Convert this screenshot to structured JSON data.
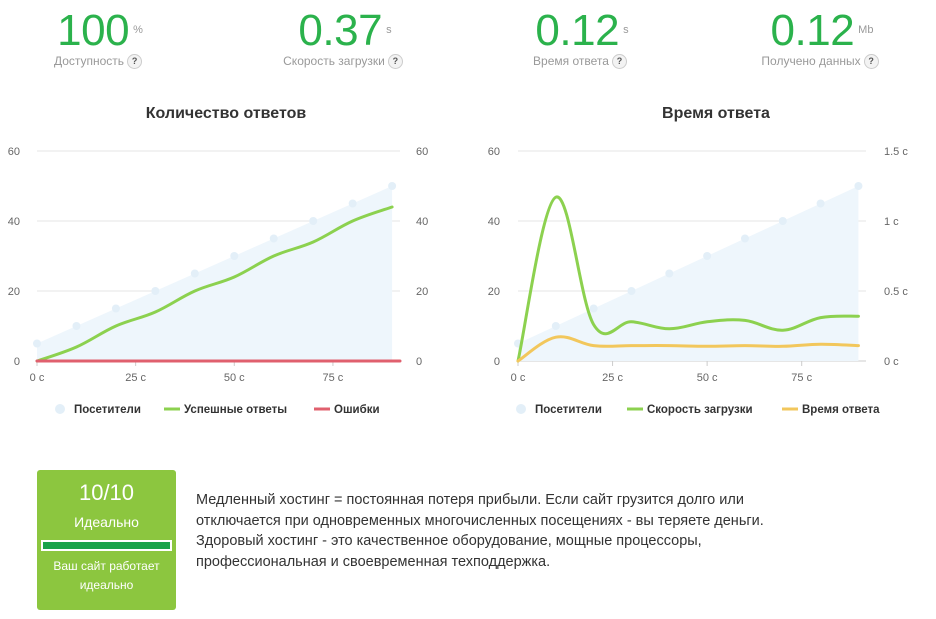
{
  "stats": [
    {
      "value": "100",
      "unit": "%",
      "label": "Доступность",
      "help": "?"
    },
    {
      "value": "0.37",
      "unit": "s",
      "label": "Скорость загрузки",
      "help": "?"
    },
    {
      "value": "0.12",
      "unit": "s",
      "label": "Время ответа",
      "help": "?"
    },
    {
      "value": "0.12",
      "unit": "Mb",
      "label": "Получено данных",
      "help": "?"
    }
  ],
  "colors": {
    "accent_green": "#2bb24c",
    "visitors_fill": "#eef6fc",
    "success_line": "#8cd14f",
    "errors_line": "#e0606e",
    "response_line": "#f2c75c",
    "card_green": "#8cc63f"
  },
  "chart_data": [
    {
      "type": "line",
      "title": "Количество ответов",
      "x": [
        0,
        10,
        20,
        30,
        40,
        50,
        60,
        70,
        80,
        90
      ],
      "x_ticks": [
        "0 с",
        "25 с",
        "50 с",
        "75 с"
      ],
      "x_tick_values": [
        0,
        25,
        50,
        75
      ],
      "xlim": [
        0,
        92
      ],
      "ylim": [
        0,
        60
      ],
      "y_ticks_left": [
        "0",
        "20",
        "40",
        "60"
      ],
      "y_ticks_right": [
        "0",
        "20",
        "40",
        "60"
      ],
      "grid": true,
      "legend_position": "bottom",
      "series": [
        {
          "name": "Посетители",
          "kind": "area",
          "color": "#eef6fc",
          "values": [
            5,
            10,
            15,
            20,
            25,
            30,
            35,
            40,
            45,
            50
          ]
        },
        {
          "name": "Успешные ответы",
          "kind": "line",
          "color": "#8cd14f",
          "values": [
            0,
            4,
            10,
            14,
            20,
            24,
            30,
            34,
            40,
            44
          ]
        },
        {
          "name": "Ошибки",
          "kind": "line",
          "color": "#e0606e",
          "values": [
            0,
            0,
            0,
            0,
            0,
            0,
            0,
            0,
            0,
            0
          ]
        }
      ]
    },
    {
      "type": "line",
      "title": "Время ответа",
      "x": [
        0,
        10,
        20,
        30,
        40,
        50,
        60,
        70,
        80,
        90
      ],
      "x_ticks": [
        "0 с",
        "25 с",
        "50 с",
        "75 с"
      ],
      "x_tick_values": [
        0,
        25,
        50,
        75
      ],
      "xlim": [
        0,
        92
      ],
      "ylim": [
        0,
        60
      ],
      "y2lim": [
        0,
        1.5
      ],
      "y_ticks_left": [
        "0",
        "20",
        "40",
        "60"
      ],
      "y_ticks_right": [
        "0 с",
        "0.5 с",
        "1 с",
        "1.5 с"
      ],
      "grid": true,
      "legend_position": "bottom",
      "series": [
        {
          "name": "Посетители",
          "kind": "area",
          "axis": "left",
          "color": "#eef6fc",
          "values": [
            5,
            10,
            15,
            20,
            25,
            30,
            35,
            40,
            45,
            50
          ]
        },
        {
          "name": "Скорость загрузки",
          "kind": "line",
          "axis": "right",
          "color": "#8cd14f",
          "values": [
            0,
            1.17,
            0.26,
            0.28,
            0.23,
            0.28,
            0.29,
            0.22,
            0.31,
            0.32
          ]
        },
        {
          "name": "Время ответа",
          "kind": "line",
          "axis": "right",
          "color": "#f2c75c",
          "values": [
            0,
            0.17,
            0.11,
            0.11,
            0.11,
            0.105,
            0.11,
            0.105,
            0.12,
            0.11
          ]
        }
      ]
    }
  ],
  "score": {
    "value": "10/10",
    "grade": "Идеально",
    "fill_fraction": 1.0,
    "note_line1": "Ваш сайт работает",
    "note_line2": "идеально"
  },
  "message": {
    "line1": "Медленный хостинг = постоянная потеря прибыли. Если сайт грузится долго или",
    "line2": "отключается при одновременных многочисленных посещениях - вы теряете деньги.",
    "line3": "Здоровый хостинг - это качественное оборудование, мощные процессоры,",
    "line4": "профессиональная и своевременная техподдержка."
  }
}
